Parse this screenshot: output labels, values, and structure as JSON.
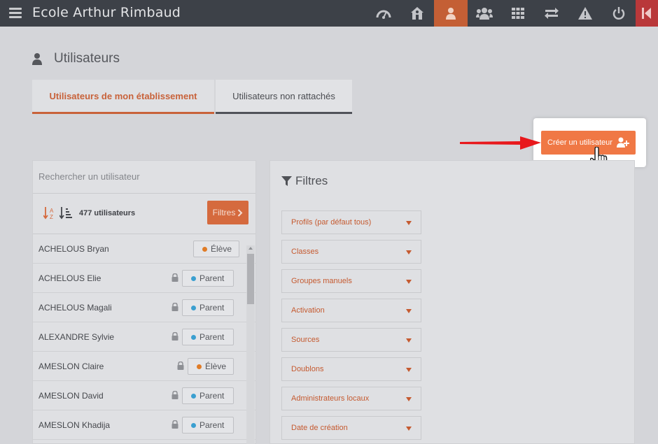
{
  "app": {
    "title": "Ecole Arthur Rimbaud"
  },
  "nav": {
    "icons": [
      "dashboard-icon",
      "school-icon",
      "user-icon",
      "users-group-icon",
      "grid-icon",
      "exchange-icon",
      "warning-icon",
      "power-icon",
      "collapse-icon"
    ],
    "active_color": "#c45f35",
    "accent_red": "#b9383a"
  },
  "page": {
    "title": "Utilisateurs"
  },
  "tabs": [
    {
      "label": "Utilisateurs de mon établissement"
    },
    {
      "label": "Utilisateurs non rattachés"
    }
  ],
  "create_button": {
    "label": "Créer un utilisateur"
  },
  "search": {
    "placeholder": "Rechercher un utilisateur"
  },
  "list": {
    "count_label": "477 utilisateurs",
    "filters_button": "Filtres",
    "users": [
      {
        "name": "ACHELOUS Bryan",
        "role": "Élève",
        "locked": false
      },
      {
        "name": "ACHELOUS Elie",
        "role": "Parent",
        "locked": true
      },
      {
        "name": "ACHELOUS Magali",
        "role": "Parent",
        "locked": true
      },
      {
        "name": "ALEXANDRE Sylvie",
        "role": "Parent",
        "locked": true
      },
      {
        "name": "AMESLON Claire",
        "role": "Élève",
        "locked": true
      },
      {
        "name": "AMESLON David",
        "role": "Parent",
        "locked": true
      },
      {
        "name": "AMESLON Khadija",
        "role": "Parent",
        "locked": true
      }
    ],
    "role_colors": {
      "Élève": "#e07c27",
      "Parent": "#3a9fd0"
    }
  },
  "filters": {
    "title": "Filtres",
    "items": [
      "Profils (par défaut tous)",
      "Classes",
      "Groupes manuels",
      "Activation",
      "Sources",
      "Doublons",
      "Administrateurs locaux",
      "Date de création"
    ]
  },
  "colors": {
    "accent": "#f07845",
    "accent_text": "#c55a30"
  }
}
